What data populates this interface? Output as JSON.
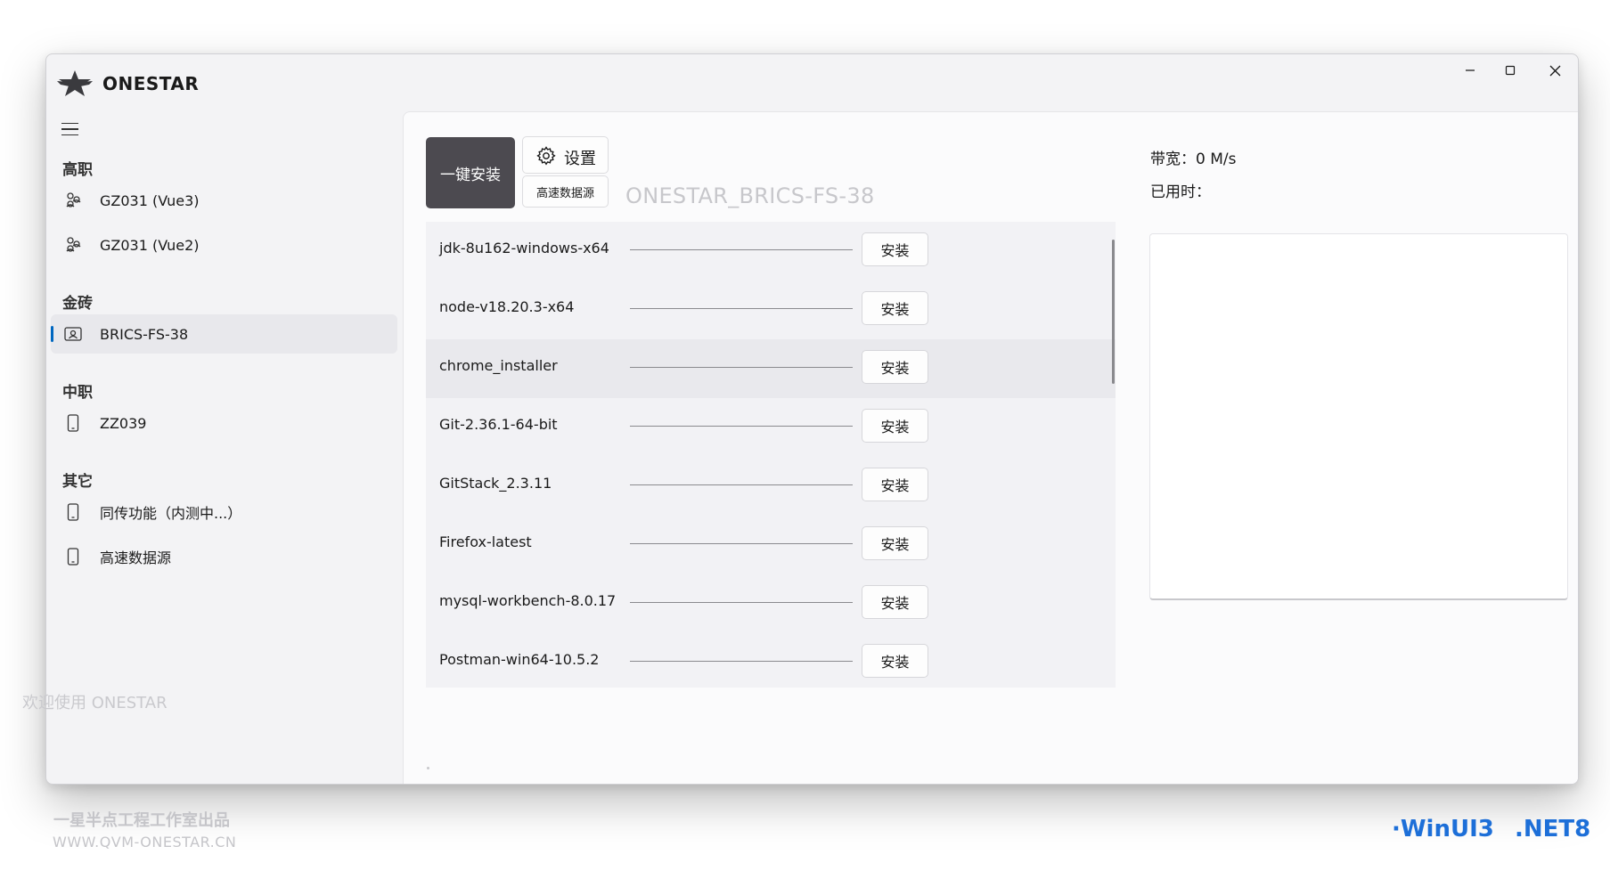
{
  "app": {
    "title": "ONESTAR",
    "logo_icon": "star-emblem-icon"
  },
  "window_controls": {
    "minimize_icon": "minimize-icon",
    "maximize_icon": "maximize-icon",
    "close_icon": "close-icon"
  },
  "sidebar": {
    "menu_icon": "hamburger-menu-icon",
    "sections": [
      {
        "header": "高职",
        "items": [
          {
            "label": "GZ031 (Vue3)",
            "icon": "nodes-icon"
          },
          {
            "label": "GZ031 (Vue2)",
            "icon": "nodes-icon"
          }
        ]
      },
      {
        "header": "金砖",
        "items": [
          {
            "label": "BRICS-FS-38",
            "icon": "id-card-icon",
            "selected": true
          }
        ]
      },
      {
        "header": "中职",
        "items": [
          {
            "label": "ZZ039",
            "icon": "phone-icon"
          }
        ]
      },
      {
        "header": "其它",
        "items": [
          {
            "label": "同传功能（内测中...）",
            "icon": "phone-icon"
          },
          {
            "label": "高速数据源",
            "icon": "phone-icon"
          }
        ]
      }
    ]
  },
  "toolbar": {
    "install_all_label": "一键安装",
    "settings_label": "设置",
    "settings_icon": "gear-icon",
    "datasource_label": "高速数据源",
    "target_label": "ONESTAR_BRICS-FS-38"
  },
  "packages": [
    {
      "name": "jdk-8u162-windows-x64",
      "button": "安装",
      "progress": 0
    },
    {
      "name": "node-v18.20.3-x64",
      "button": "安装",
      "progress": 0
    },
    {
      "name": "chrome_installer",
      "button": "安装",
      "progress": 0
    },
    {
      "name": "Git-2.36.1-64-bit",
      "button": "安装",
      "progress": 0
    },
    {
      "name": "GitStack_2.3.11",
      "button": "安装",
      "progress": 0
    },
    {
      "name": "Firefox-latest",
      "button": "安装",
      "progress": 0
    },
    {
      "name": "mysql-workbench-8.0.17",
      "button": "安装",
      "progress": 0
    },
    {
      "name": "Postman-win64-10.5.2",
      "button": "安装",
      "progress": 0
    }
  ],
  "status": {
    "bandwidth_label": "带宽：0 M/s",
    "elapsed_label": "已用时："
  },
  "welcome_text": "欢迎使用 ONESTAR",
  "footer": {
    "studio": "一星半点工程工作室出品",
    "url": "WWW.QVM-ONESTAR.CN",
    "tag_winui": "·WinUI3",
    "tag_net": ".NET8"
  },
  "colors": {
    "accent": "#0067c0",
    "install_all_bg": "#4c4a50",
    "footer_accent": "#1d6fd8"
  }
}
